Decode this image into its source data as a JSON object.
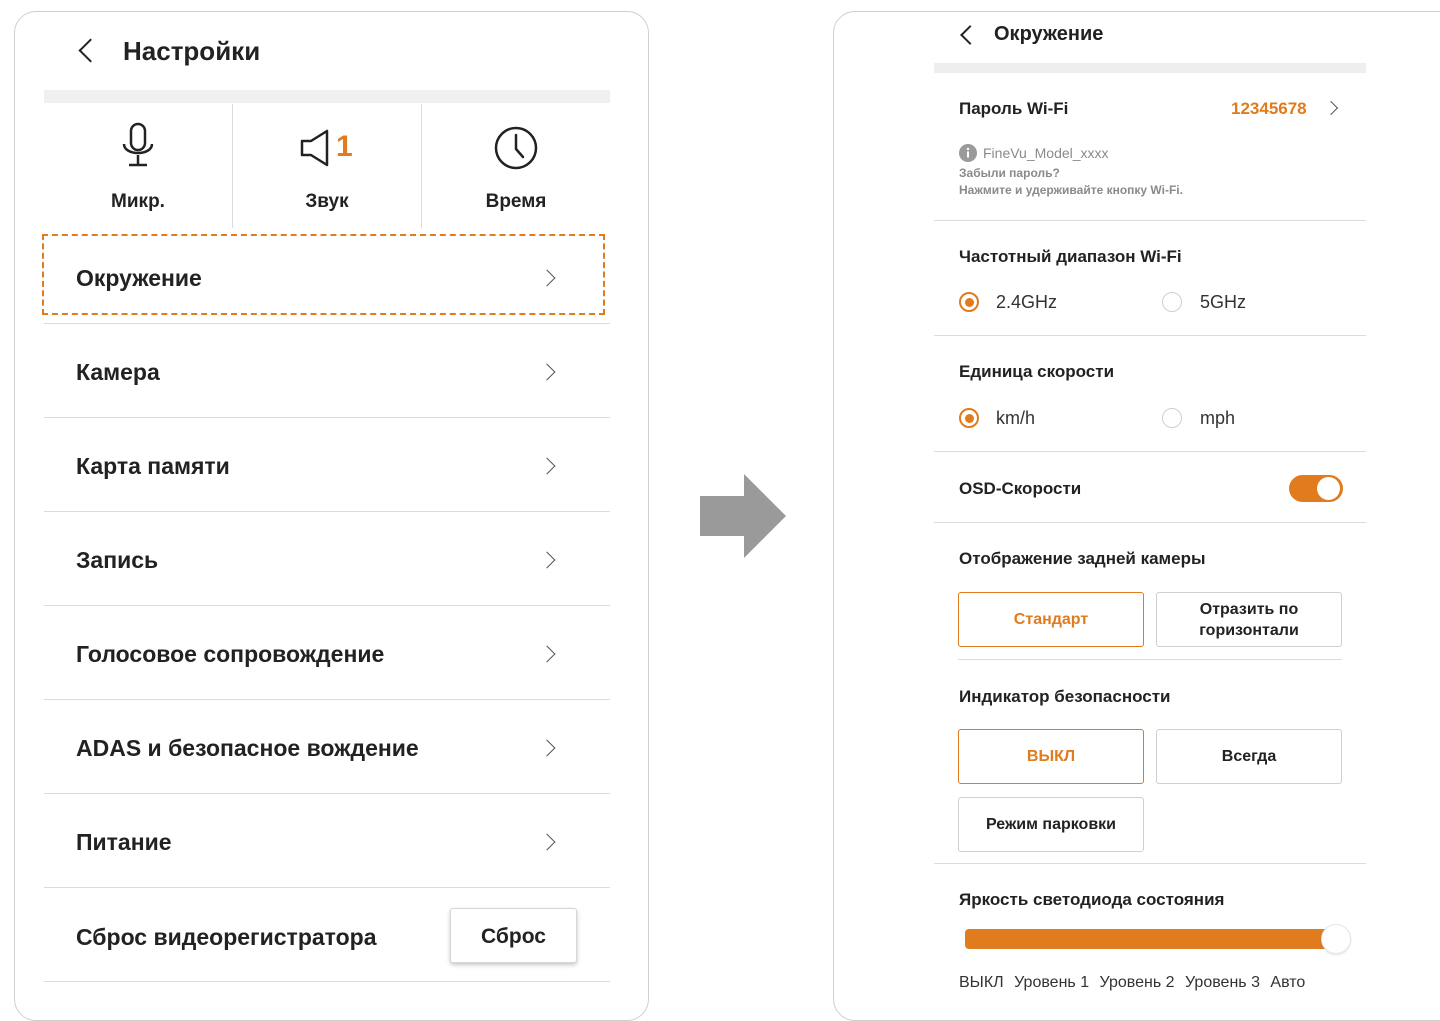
{
  "left": {
    "title": "Настройки",
    "quick": [
      {
        "icon": "microphone-icon",
        "label": "Микр."
      },
      {
        "icon": "speaker-icon",
        "label": "Звук",
        "value": "1"
      },
      {
        "icon": "clock-icon",
        "label": "Время"
      }
    ],
    "menu": [
      "Окружение",
      "Камера",
      "Карта памяти",
      "Запись",
      "Голосовое сопровождение",
      "ADAS и безопасное вождение",
      "Питание"
    ],
    "reset_label": "Сброс видеорегистратора",
    "reset_button": "Сброс"
  },
  "right": {
    "title": "Окружение",
    "wifi_password_label": "Пароль Wi-Fi",
    "wifi_password_value": "12345678",
    "ssid": "FineVu_Model_xxxx",
    "forgot_line1": "Забыли пароль?",
    "forgot_line2": "Нажмите и удерживайте кнопку Wi-Fi.",
    "band_label": "Частотный диапазон Wi-Fi",
    "band_options": [
      "2.4GHz",
      "5GHz"
    ],
    "band_selected": "2.4GHz",
    "speed_unit_label": "Единица скорости",
    "speed_unit_options": [
      "km/h",
      "mph"
    ],
    "speed_unit_selected": "km/h",
    "osd_speed_label": "OSD-Скорости",
    "osd_speed_on": true,
    "rear_cam_label": "Отображение задней камеры",
    "rear_cam_options": [
      "Стандарт",
      "Отразить по горизонтали"
    ],
    "rear_cam_selected": "Стандарт",
    "safety_label": "Индикатор безопасности",
    "safety_options": [
      "ВЫКЛ",
      "Всегда",
      "Режим парковки"
    ],
    "safety_selected": "ВЫКЛ",
    "led_label": "Яркость светодиода состояния",
    "led_levels": [
      "ВЫКЛ",
      "Уровень 1",
      "Уровень 2",
      "Уровень 3",
      "Авто"
    ],
    "led_selected": "Авто"
  },
  "colors": {
    "accent": "#e07b1e",
    "arrow": "#9a9a9a",
    "divider": "#dcdcdc"
  }
}
